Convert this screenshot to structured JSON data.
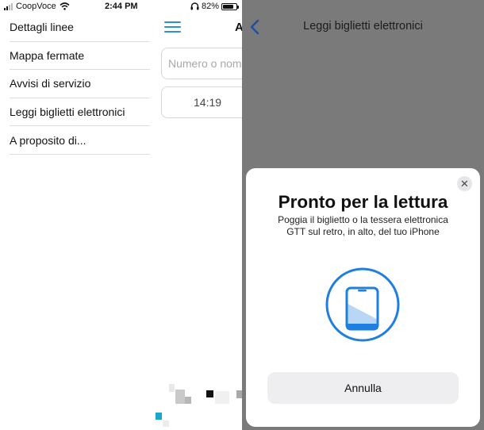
{
  "status_bar": {
    "carrier": "CoopVoce",
    "time": "2:44 PM",
    "battery": "82%",
    "battery_level": 0.82,
    "icons": [
      "signal-icon",
      "wifi-icon",
      "headphones-icon",
      "battery-icon"
    ]
  },
  "menu": {
    "items": [
      {
        "label": "Dettagli linee"
      },
      {
        "label": "Mappa fermate"
      },
      {
        "label": "Avvisi di servizio"
      },
      {
        "label": "Leggi biglietti elettronici"
      },
      {
        "label": "A proposito di..."
      }
    ]
  },
  "main_view": {
    "title_fragment": "A",
    "search_placeholder": "Numero o nome",
    "time_value": "14:19"
  },
  "nfc_screen": {
    "nav_title": "Leggi biglietti elettronici",
    "sheet_title": "Pronto per la lettura",
    "sheet_message": "Poggia il biglietto o la tessera elettronica\nGTT sul retro, in alto, del tuo iPhone",
    "cancel_label": "Annulla",
    "close_glyph": "✕"
  },
  "colors": {
    "accent_blue": "#2f8fd8",
    "nfc_blue": "#1f7fe0",
    "overlay_gray": "#7a7a7a",
    "artifact_teal": "#1aa7c9"
  }
}
